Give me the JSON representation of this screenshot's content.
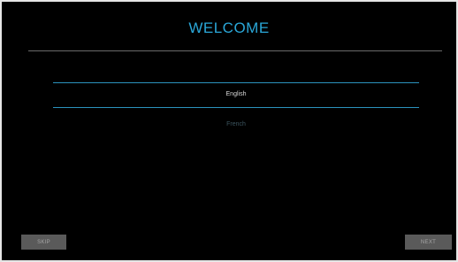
{
  "header": {
    "title": "WELCOME"
  },
  "language_picker": {
    "selected": "English",
    "options": [
      "English",
      "French"
    ]
  },
  "footer": {
    "skip_label": "SKIP",
    "next_label": "NEXT"
  },
  "colors": {
    "background": "#000000",
    "accent": "#2aa7d8",
    "button": "#5a5a5a",
    "button_text": "#a6a6a6"
  }
}
